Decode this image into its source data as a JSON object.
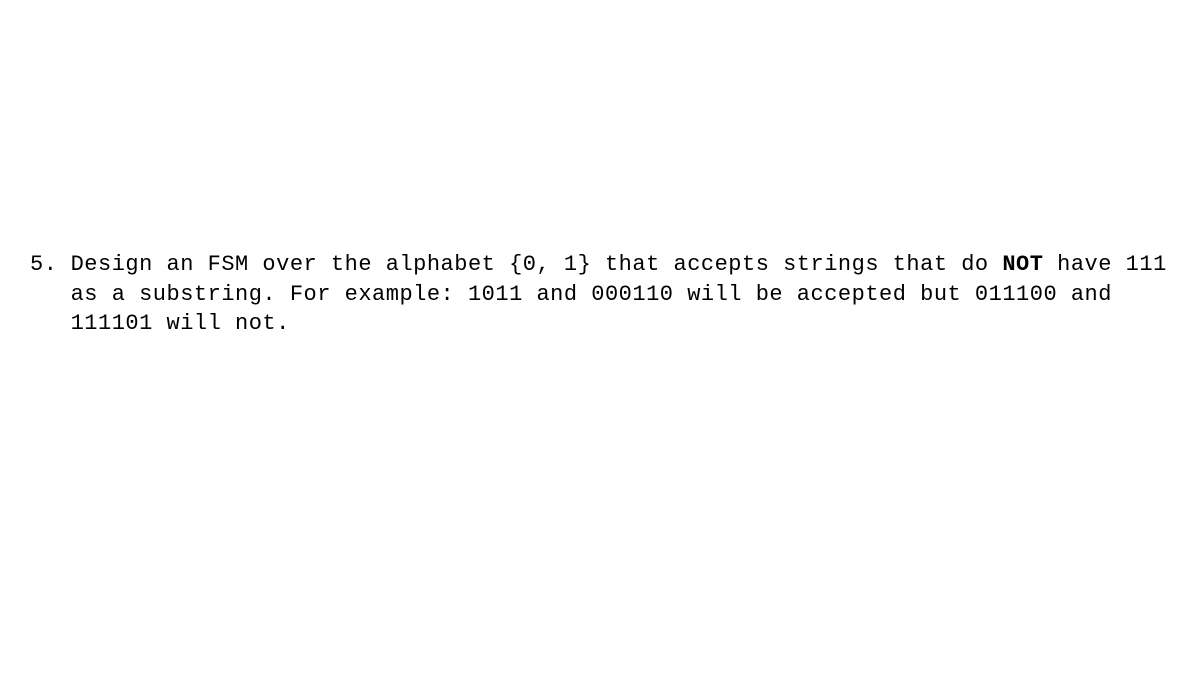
{
  "question": {
    "number": "5.",
    "part1": "Design an FSM over the alphabet {0, 1} that accepts strings that do ",
    "bold": "NOT",
    "part2": " have 111 as a substring. For example: 1011 and 000110 will be accepted but 011100 and 111101 will not."
  }
}
